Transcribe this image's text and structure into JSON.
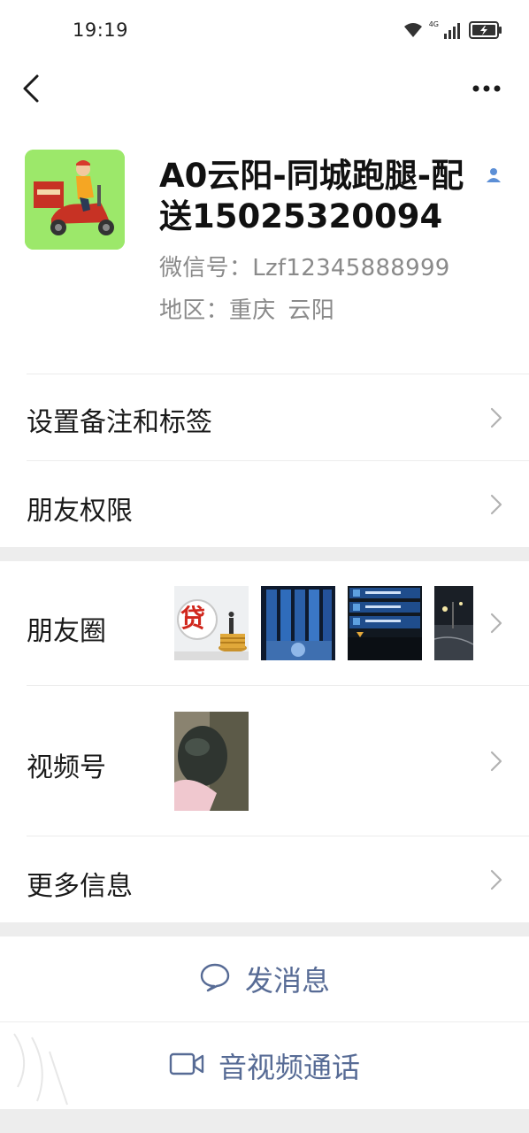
{
  "status": {
    "time": "19:19",
    "network": "4G"
  },
  "profile": {
    "name": "A0云阳-同城跑腿-配送15025320094",
    "wechat_id": "微信号：Lzf12345888999",
    "region_label": "地区：重庆",
    "region_city": "云阳"
  },
  "rows": {
    "remark": "设置备注和标签",
    "permission": "朋友权限",
    "moments": "朋友圈",
    "moments_thumb_1_text": "贷",
    "channels": "视频号",
    "more_info": "更多信息"
  },
  "actions": {
    "message": "发消息",
    "call": "音视频通话"
  },
  "colors": {
    "link_blue": "#576b95",
    "avatar_green": "#9ce86a",
    "badge_blue": "#5c8fd6"
  },
  "icons": [
    "back-icon",
    "more-icon",
    "contact-badge-icon",
    "chevron-icon",
    "chat-bubble-icon",
    "video-camera-icon"
  ]
}
